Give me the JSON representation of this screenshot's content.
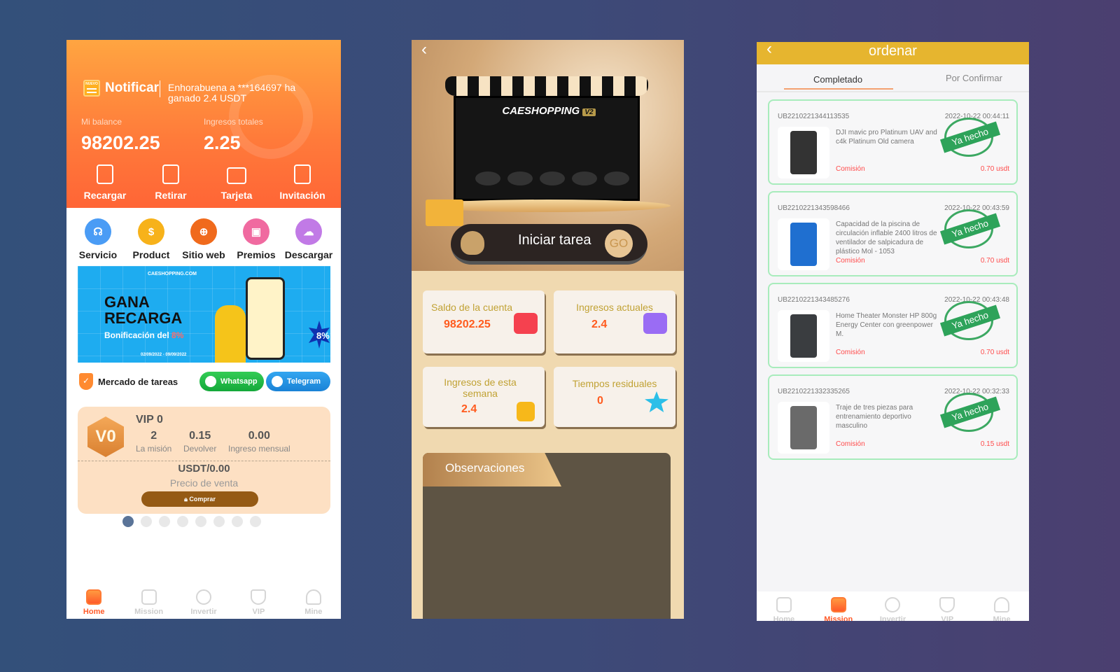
{
  "home": {
    "notify_label": "Notificar",
    "notify_badge": "NUEVO",
    "notify_text": "Enhorabuena a ***164697 ha ganado 2.4 USDT",
    "balance_label": "Mi balance",
    "balance": "98202.25",
    "total_label": "Ingresos totales",
    "total": "2.25",
    "actions": [
      {
        "label": "Recargar",
        "icon": "tablet-icon"
      },
      {
        "label": "Retirar",
        "icon": "wallet-icon"
      },
      {
        "label": "Tarjeta",
        "icon": "card-icon"
      },
      {
        "label": "Invitación",
        "icon": "bookmark-icon"
      }
    ],
    "services": [
      {
        "label": "Servicio",
        "icon": "headset-icon",
        "color": "#4a9cf5"
      },
      {
        "label": "Product",
        "icon": "dollar-icon",
        "color": "#f7b21a"
      },
      {
        "label": "Sitio web",
        "icon": "globe-icon",
        "color": "#f06a1c"
      },
      {
        "label": "Premios",
        "icon": "gift-icon",
        "color": "#f06aa0"
      },
      {
        "label": "Descargar",
        "icon": "cloud-download-icon",
        "color": "#c17ae6"
      }
    ],
    "banner": {
      "site": "CAESHOPPING.COM",
      "line1": "GANA",
      "line2": "RECARGA",
      "bonus_prefix": "Bonificación del ",
      "bonus_pct": "8%",
      "dates": "02/09/2022 - 09/09/2022",
      "badge": "8%"
    },
    "market_title": "Mercado de tareas",
    "whatsapp": "Whatsapp",
    "telegram": "Telegram",
    "vip": {
      "badge": "V0",
      "title": "VIP 0",
      "stats": [
        {
          "value": "2",
          "label": "La misión"
        },
        {
          "value": "0.15",
          "label": "Devolver"
        },
        {
          "value": "0.00",
          "label": "Ingreso mensual"
        }
      ],
      "price": "USDT/0.00",
      "price_label": "Precio de venta",
      "buy": "Comprar"
    },
    "carousel": {
      "count": 8,
      "active": 0
    }
  },
  "tabbar": [
    {
      "label": "Home",
      "icon": "home-icon"
    },
    {
      "label": "Mission",
      "icon": "mission-icon"
    },
    {
      "label": "Invertir",
      "icon": "pie-chart-icon"
    },
    {
      "label": "VIP",
      "icon": "vip-shield-icon"
    },
    {
      "label": "Mine",
      "icon": "user-icon"
    }
  ],
  "task": {
    "shop_name": "CAESHOPPING",
    "shop_badge": "V2",
    "start_label": "Iniciar tarea",
    "go": "GO",
    "cards": [
      {
        "label": "Saldo de la cuenta",
        "value": "98202.25",
        "icon": "wallet-icon",
        "color": "#f5414f"
      },
      {
        "label": "Ingresos actuales",
        "value": "2.4",
        "icon": "trend-chart-icon",
        "color": "#9a6cf4"
      },
      {
        "label": "Ingresos de esta semana",
        "value": "2.4",
        "icon": "coin-stack-icon",
        "color": "#f7b81a"
      },
      {
        "label": "Tiempos residuales",
        "value": "0",
        "icon": "star-dollar-icon",
        "color": "#2bbfe8"
      }
    ],
    "observations": "Observaciones"
  },
  "orders": {
    "title": "ordenar",
    "tabs": [
      "Completado",
      "Por Confirmar"
    ],
    "commission_label": "Comisión",
    "stamp": "Ya hecho",
    "items": [
      {
        "id": "UB2210221344113535",
        "date": "2022-10-22 00:44:11",
        "name": "DJI mavic pro Platinum UAV and c4k Platinum Old camera",
        "amount": "0.70 usdt",
        "thumb": "#333"
      },
      {
        "id": "UB2210221343598466",
        "date": "2022-10-22 00:43:59",
        "name": "Capacidad de la piscina de circulación inflable 2400 litros de ventilador de salpicadura de plástico Mol - 1053",
        "amount": "0.70 usdt",
        "thumb": "#1f6fd0"
      },
      {
        "id": "UB2210221343485276",
        "date": "2022-10-22 00:43:48",
        "name": "Home Theater Monster HP 800g Energy Center con greenpower M.",
        "amount": "0.70 usdt",
        "thumb": "#3a3d40"
      },
      {
        "id": "UB2210221332335265",
        "date": "2022-10-22 00:32:33",
        "name": "Traje de tres piezas para entrenamiento deportivo masculino",
        "amount": "0.15 usdt",
        "thumb": "#6a6a6a"
      }
    ]
  }
}
